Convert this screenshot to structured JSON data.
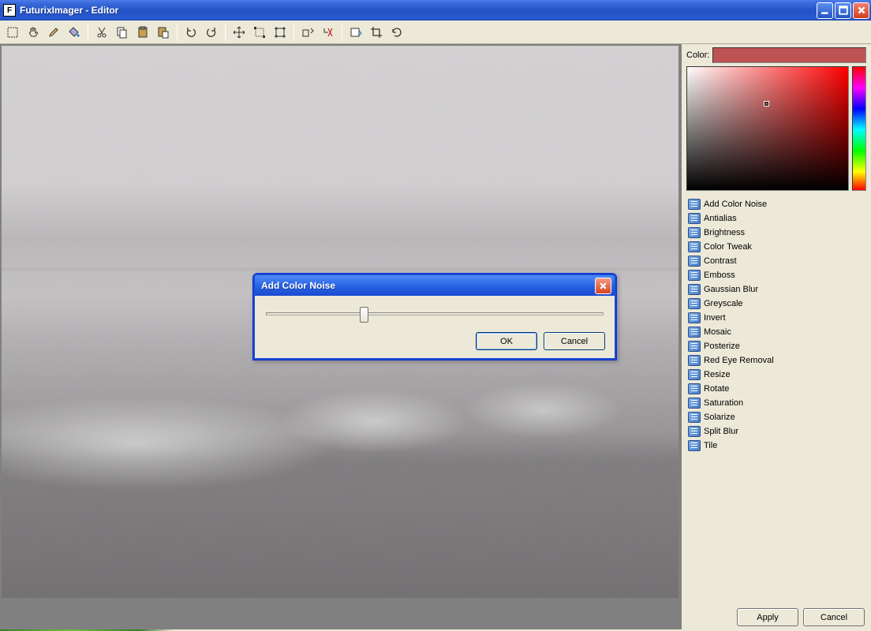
{
  "titlebar": {
    "title": "FuturixImager - Editor"
  },
  "colors": {
    "accent": "#2a5bd0",
    "swatch": "#bd5353"
  },
  "toolbar": {
    "groups": [
      [
        "select-rect",
        "hand",
        "pencil",
        "fill"
      ],
      [
        "cut",
        "copy",
        "paste",
        "paste-into"
      ],
      [
        "undo",
        "redo"
      ],
      [
        "move",
        "crop",
        "resize-handles"
      ],
      [
        "rot-left",
        "rot-right"
      ],
      [
        "export",
        "crop-tool",
        "refresh"
      ]
    ]
  },
  "right": {
    "color_label": "Color:",
    "effects": [
      "Add Color Noise",
      "Antialias",
      "Brightness",
      "Color Tweak",
      "Contrast",
      "Emboss",
      "Gaussian Blur",
      "Greyscale",
      "Invert",
      "Mosaic",
      "Posterize",
      "Red Eye Removal",
      "Resize",
      "Rotate",
      "Saturation",
      "Solarize",
      "Split Blur",
      "Tile"
    ]
  },
  "footer": {
    "apply": "Apply",
    "cancel": "Cancel"
  },
  "dialog": {
    "title": "Add Color Noise",
    "slider_value": 28,
    "ok": "OK",
    "cancel": "Cancel"
  }
}
